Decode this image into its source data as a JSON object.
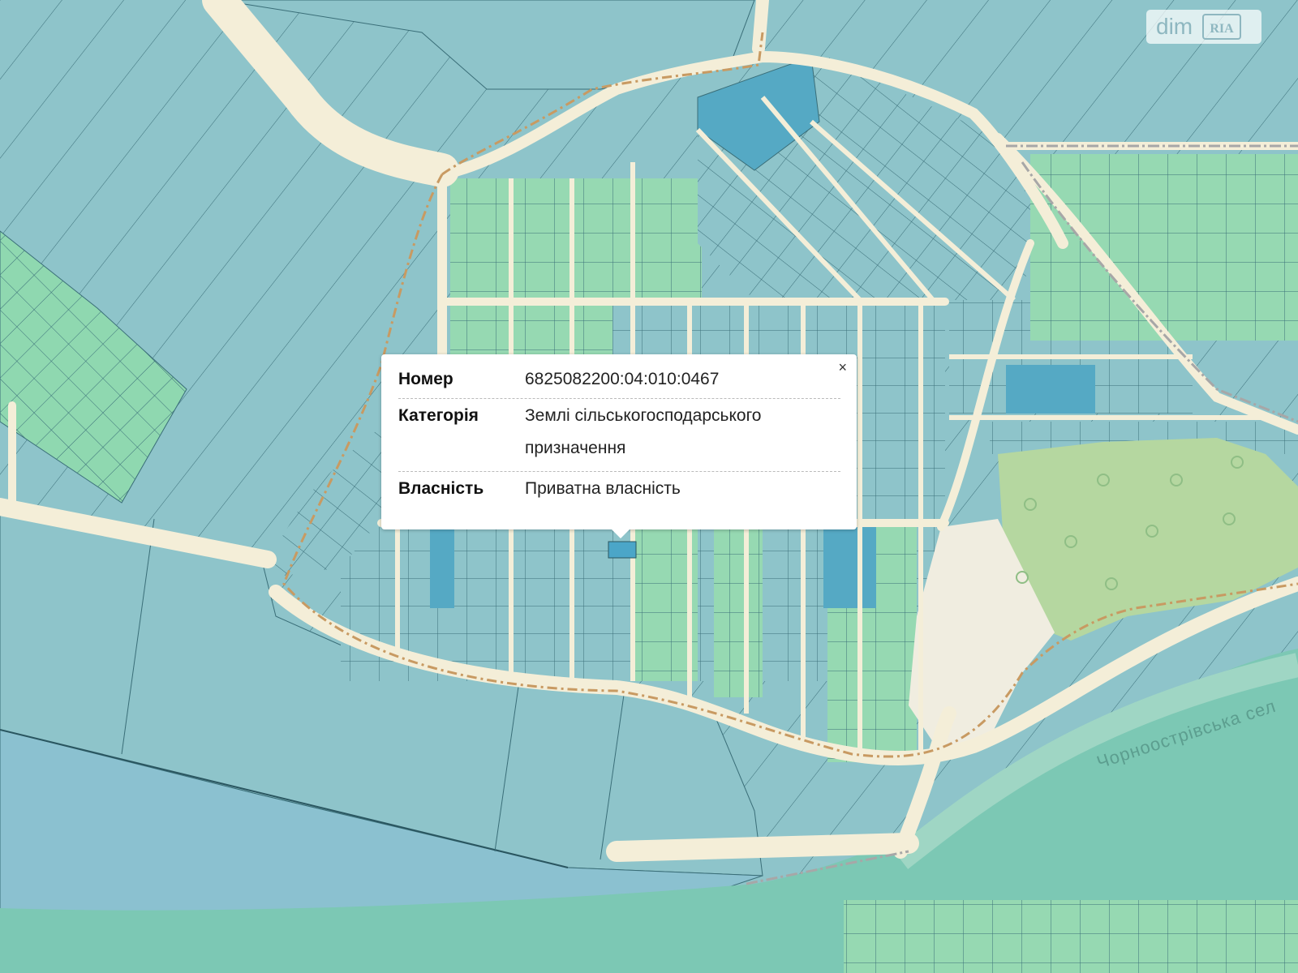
{
  "map": {
    "colors": {
      "background": "#8ec4ca",
      "parcel_blue": "#8ec4ca",
      "parcel_green": "#96d9b2",
      "parcel_deep": "#55a9c4",
      "parcel_mint": "#7fd0a8",
      "roads": "#f4eed8",
      "river": "#7cc8b4",
      "forest": "#b5d7a0",
      "border_line": "#c89a62",
      "parcel_outline": "#3a6e78"
    },
    "river_label": "Чорноострівська сел"
  },
  "popup": {
    "close_symbol": "×",
    "rows": [
      {
        "label": "Номер",
        "value": "6825082200:04:010:0467"
      },
      {
        "label": "Категорія",
        "value": "Землі сільськогосподарського призначення"
      },
      {
        "label": "Власність",
        "value": "Приватна власність"
      }
    ]
  },
  "watermark": {
    "text": "dim",
    "logo": "RIA"
  }
}
